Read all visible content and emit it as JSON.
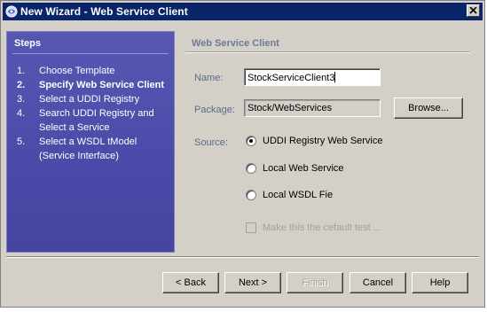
{
  "window": {
    "title": "New Wizard - Web Service Client"
  },
  "steps": {
    "heading": "Steps",
    "items": [
      {
        "num": "1.",
        "lines": [
          "Choose Template"
        ],
        "current": false
      },
      {
        "num": "2.",
        "lines": [
          "Specify Web Service Client"
        ],
        "current": true
      },
      {
        "num": "3.",
        "lines": [
          "Select a UDDI Registry"
        ],
        "current": false
      },
      {
        "num": "4.",
        "lines": [
          "Search UDDI Registry and",
          "Select a Service"
        ],
        "current": false
      },
      {
        "num": "5.",
        "lines": [
          "Select a WSDL tModel",
          "(Service Interface)"
        ],
        "current": false
      }
    ]
  },
  "content": {
    "heading": "Web Service Client",
    "name_label": "Name:",
    "name_value": "StockServiceClient3",
    "package_label": "Package:",
    "package_value": "Stock/WebServices",
    "browse_label": "Browse...",
    "source_label": "Source:",
    "sources": [
      {
        "label": "UDDI Registry Web Service",
        "selected": true
      },
      {
        "label": "Local Web Service",
        "selected": false
      },
      {
        "label": "Local WSDL Fie",
        "selected": false
      }
    ],
    "default_test_label": "Make this the cefault test ..."
  },
  "buttons": {
    "back": "< Back",
    "next": "Next >",
    "finish": "Finish",
    "cancel": "Cancel",
    "help": "Help"
  },
  "colors": {
    "title_bar": "#0a246a",
    "steps_panel": "#4a4aa8",
    "window_bg": "#d4d0c8",
    "label_text": "#5a6a89"
  }
}
